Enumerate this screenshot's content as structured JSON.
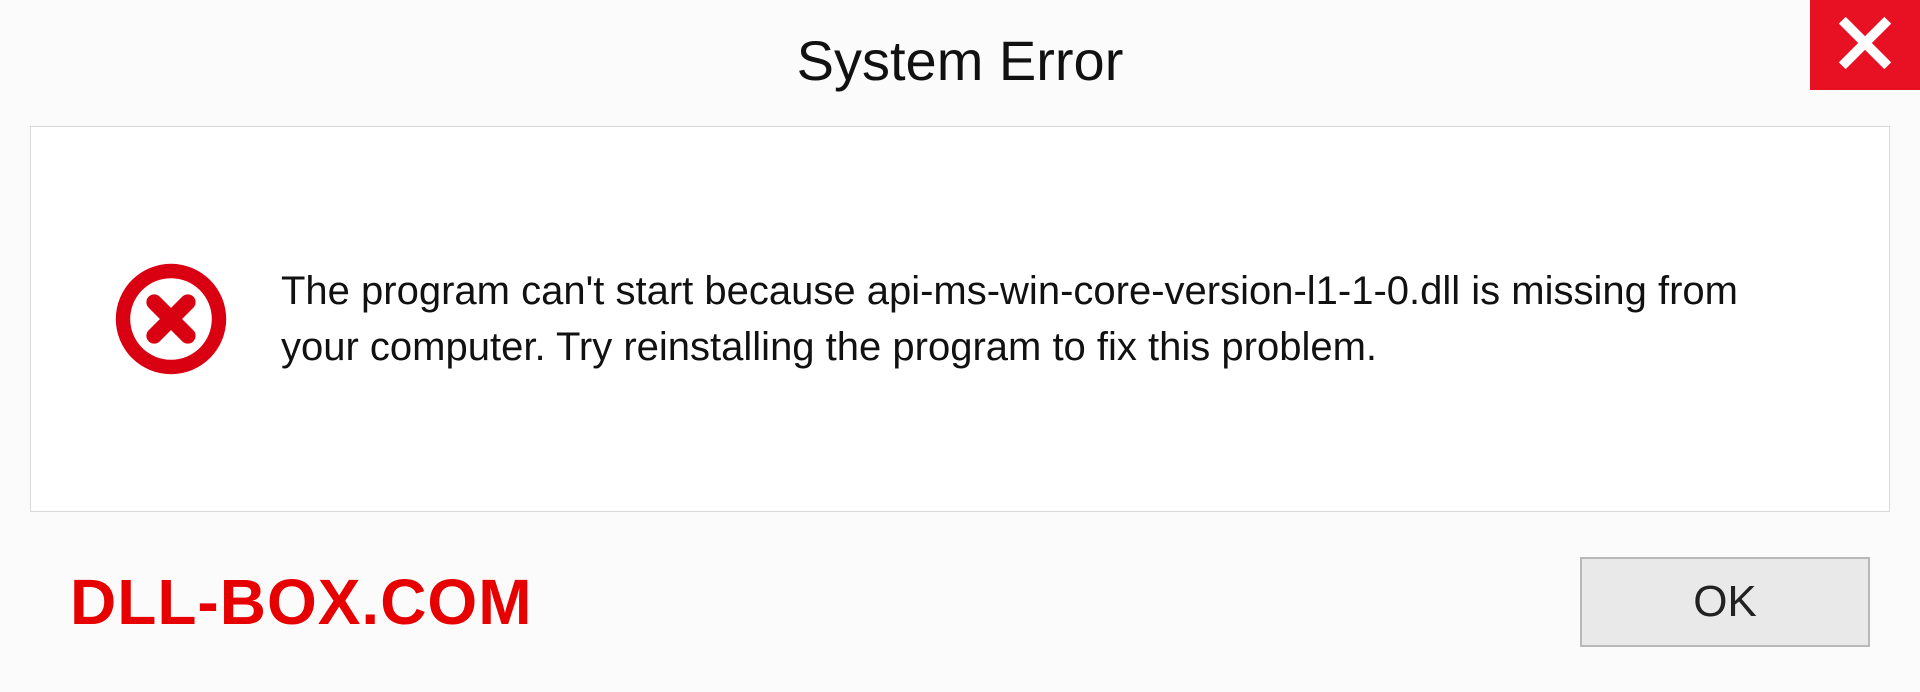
{
  "dialog": {
    "title": "System Error",
    "message": "The program can't start because api-ms-win-core-version-l1-1-0.dll is missing from your computer. Try reinstalling the program to fix this problem.",
    "ok_label": "OK"
  },
  "watermark": "DLL-BOX.COM",
  "colors": {
    "close_bg": "#e81123",
    "error_icon": "#d90012",
    "watermark": "#e60000"
  }
}
